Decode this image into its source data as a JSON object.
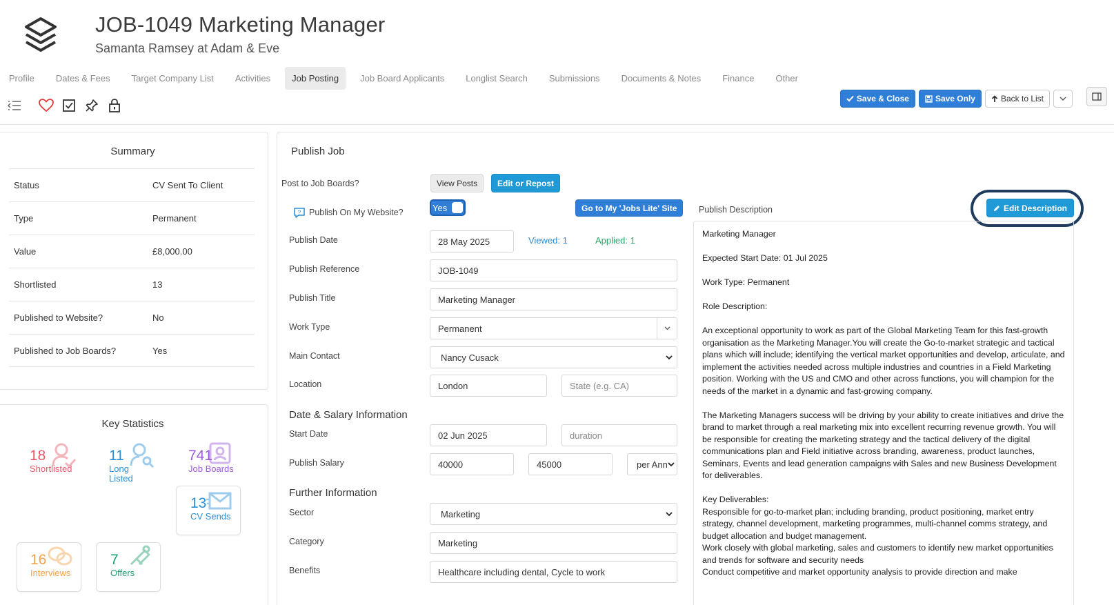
{
  "header": {
    "title": "JOB-1049 Marketing Manager",
    "subtitle": "Samanta Ramsey at Adam & Eve"
  },
  "tabs": [
    {
      "label": "Profile"
    },
    {
      "label": "Dates & Fees"
    },
    {
      "label": "Target Company List"
    },
    {
      "label": "Activities"
    },
    {
      "label": "Job Posting",
      "active": true
    },
    {
      "label": "Job Board Applicants"
    },
    {
      "label": "Longlist Search"
    },
    {
      "label": "Submissions"
    },
    {
      "label": "Documents & Notes"
    },
    {
      "label": "Finance"
    },
    {
      "label": "Other"
    }
  ],
  "toolbar": {
    "icons": [
      "collapse-menu-icon",
      "heart-icon",
      "checkbox-icon",
      "pin-icon",
      "lock-icon"
    ],
    "save_close": "Save & Close",
    "save_only": "Save Only",
    "back_to_list": "Back to List"
  },
  "summary": {
    "title": "Summary",
    "rows": [
      {
        "label": "Status",
        "value": "CV Sent To Client"
      },
      {
        "label": "Type",
        "value": "Permanent"
      },
      {
        "label": "Value",
        "value": "£8,000.00"
      },
      {
        "label": "Shortlisted",
        "value": "13"
      },
      {
        "label": "Published to Website?",
        "value": "No"
      },
      {
        "label": "Published to Job Boards?",
        "value": "Yes"
      }
    ]
  },
  "key_stats": {
    "title": "Key Statistics",
    "items": [
      {
        "num": "18",
        "label": "Shortlisted",
        "color": "#e85a6a"
      },
      {
        "num": "11",
        "label": "Long Listed",
        "color": "#2a8fd6"
      },
      {
        "num": "741",
        "label": "Job Boards",
        "color": "#9b5bd8"
      },
      {
        "num": "13",
        "label": "CV Sends",
        "color": "#2a8fd6"
      },
      {
        "num": "16",
        "label": "Interviews",
        "color": "#f3a24a"
      },
      {
        "num": "7",
        "label": "Offers",
        "color": "#1f9e6e"
      }
    ]
  },
  "publish": {
    "title": "Publish Job",
    "post_to_boards_label": "Post to Job Boards?",
    "view_posts": "View Posts",
    "edit_or_repost": "Edit or Repost",
    "publish_website_label": "Publish On My Website?",
    "toggle_label": "Yes",
    "go_to_site": "Go to My 'Jobs Lite' Site",
    "publish_date_label": "Publish Date",
    "publish_date": "28 May 2025",
    "viewed": "Viewed: 1",
    "applied": "Applied: 1",
    "reference_label": "Publish Reference",
    "reference": "JOB-1049",
    "title_label": "Publish Title",
    "title_value": "Marketing Manager",
    "work_type_label": "Work Type",
    "work_type": "Permanent",
    "main_contact_label": "Main Contact",
    "main_contact": "Nancy Cusack",
    "location_label": "Location",
    "location": "London",
    "state_placeholder": "State (e.g. CA)",
    "date_salary_heading": "Date & Salary Information",
    "start_date_label": "Start Date",
    "start_date": "02 Jun 2025",
    "duration_placeholder": "duration",
    "salary_label": "Publish Salary",
    "salary_min": "40000",
    "salary_max": "45000",
    "salary_period": "per Ann",
    "further_heading": "Further Information",
    "sector_label": "Sector",
    "sector": "Marketing",
    "category_label": "Category",
    "category": "Marketing",
    "benefits_label": "Benefits",
    "benefits": "Healthcare including dental, Cycle to work"
  },
  "description": {
    "label": "Publish Description",
    "edit_button": "Edit Description",
    "paragraphs": [
      "Marketing Manager",
      "Expected Start Date: 01 Jul 2025",
      "Work Type: Permanent",
      "Role Description:",
      "An exceptional opportunity to work as part of the Global Marketing Team for this fast-growth organisation as the Marketing Manager.You will create the Go-to-market strategic and tactical plans which will include; identifying the vertical market opportunities and develop, articulate, and implement the activities needed across multiple industries and countries in a Field Marketing position. Working with the US and CMO and other across functions, you will champion for the needs of the market in a dynamic and fast-growing company.",
      "The Marketing Managers success will be driving by your ability to create initiatives and drive the brand to market through a real marketing mix into excellent recurring revenue growth. You will be responsible for creating the marketing strategy and the tactical delivery of the digital communications plan and Field initiative across branding, awareness, product launches, Seminars, Events and lead generation campaigns with Sales and new Business Development for deliverables."
    ],
    "deliverables_heading": "Key Deliverables:",
    "deliverables": [
      "Responsible for go-to-market plan; including branding, product positioning, market entry strategy, channel development, marketing programmes, multi-channel comms strategy, and budget allocation and budget management.",
      "Work closely with global marketing, sales and customers to identify new market opportunities and trends for software and security needs",
      "Conduct competitive and market opportunity analysis to provide direction and make"
    ]
  }
}
